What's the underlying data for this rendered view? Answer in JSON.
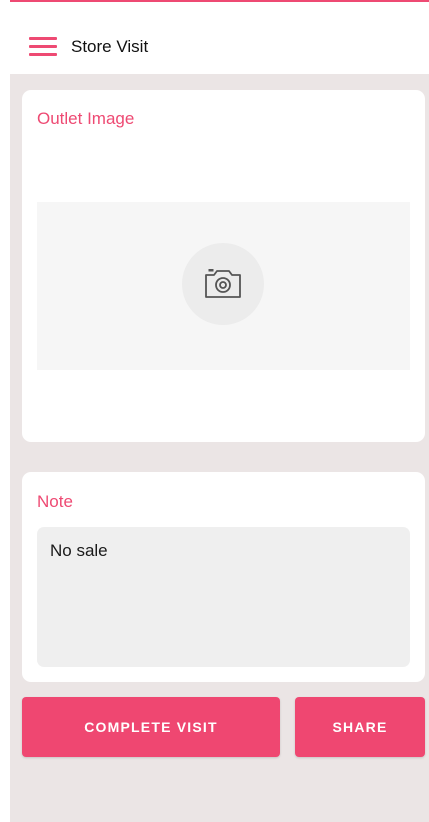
{
  "app_bar": {
    "title": "Store Visit",
    "menu_icon": "hamburger-menu-icon"
  },
  "outlet_image_card": {
    "title": "Outlet Image",
    "placeholder_icon": "camera-icon"
  },
  "note_card": {
    "title": "Note",
    "value": "No sale"
  },
  "actions": {
    "complete_label": "COMPLETE VISIT",
    "share_label": "SHARE"
  },
  "colors": {
    "accent": "#ee4a73",
    "screen_background": "#ebe5e5",
    "card_background": "#ffffff",
    "note_field_background": "#efefef"
  }
}
